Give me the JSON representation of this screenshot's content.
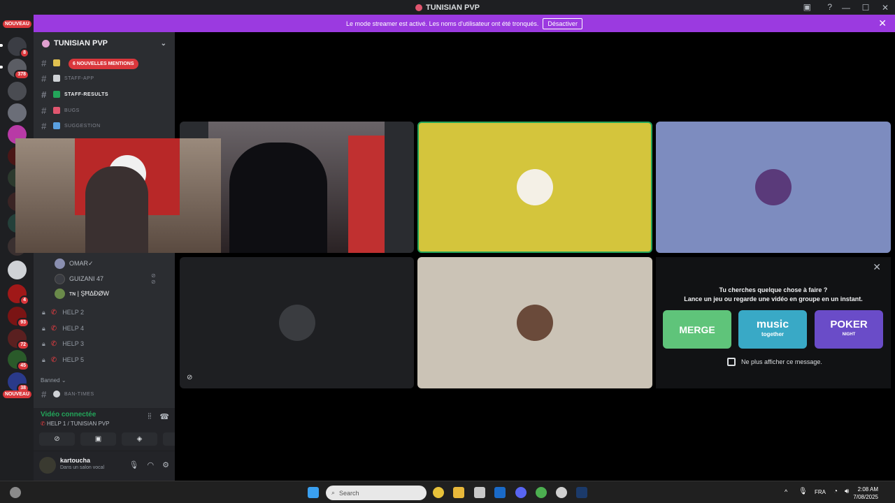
{
  "window": {
    "title": "TUNISIAN PVP"
  },
  "banner": {
    "text": "Le mode streamer est activé. Les noms d'utilisateur ont été tronqués.",
    "button": "Désactiver"
  },
  "server_rail": {
    "nouveau_top": "NOUVEAU",
    "nouveau_bottom": "NOUVEAU",
    "badges": [
      "8",
      "378",
      "4",
      "93",
      "72",
      "45",
      "38"
    ]
  },
  "sidebar": {
    "guild_name": "TUNISIAN PVP",
    "mentions_pill": "6 NOUVELLES MENTIONS",
    "text_channels": [
      {
        "name": "STAFF-APP",
        "emoji_color": "#cfd2d6",
        "unread": false
      },
      {
        "name": "STAFF-RESULTS",
        "emoji_color": "#23a55a",
        "unread": true
      },
      {
        "name": "BUGS",
        "emoji_color": "#e0566f",
        "unread": false
      },
      {
        "name": "SUGGESTION",
        "emoji_color": "#5aa0e0",
        "unread": false
      }
    ],
    "voice_users": [
      {
        "name": "OMAR✓",
        "avatar_color": "#8a8fb0"
      },
      {
        "name": "GUIZANI 47",
        "avatar_color": "#3a3c42"
      },
      {
        "name": "ᴛɴ | ŞĦΔÐØW",
        "avatar_color": "#6a8a4a"
      }
    ],
    "voice_channels": [
      "HELP 2",
      "HELP 4",
      "HELP 3",
      "HELP 5"
    ],
    "category": "Banned",
    "category_channel": "BAN-TIMES",
    "voice_panel": {
      "status": "Vidéo connectée",
      "channel": "HELP 1 / TUNISIAN PVP"
    },
    "user": {
      "name": "kartoucha",
      "status": "Dans un salon vocal"
    }
  },
  "video_grid": {
    "tiles": [
      {
        "kind": "camera",
        "description_name": "screen-share"
      },
      {
        "kind": "avatar",
        "bg": "#d4c53c",
        "speaking": true
      },
      {
        "kind": "avatar",
        "bg": "#7d8cbf",
        "speaking": false
      },
      {
        "kind": "avatar",
        "bg": "#1e1f22",
        "speaking": false
      },
      {
        "kind": "avatar",
        "bg": "#cbc3b6",
        "speaking": false
      }
    ]
  },
  "activity_card": {
    "line1": "Tu cherches quelque chose à faire ?",
    "line2": "Lance un jeu ou regarde une vidéo en groupe en un instant.",
    "games": [
      {
        "label": "MERGE",
        "color": "#5fc47a"
      },
      {
        "label": "music",
        "sub": "together",
        "color": "#39a9c6"
      },
      {
        "label": "POKER",
        "sub": "NIGHT",
        "color": "#6a4cc8"
      }
    ],
    "checkbox_label": "Ne plus afficher ce message."
  },
  "taskbar": {
    "search_placeholder": "Search",
    "lang": "FRA",
    "time": "2:08 AM",
    "date": "7/08/2025"
  }
}
